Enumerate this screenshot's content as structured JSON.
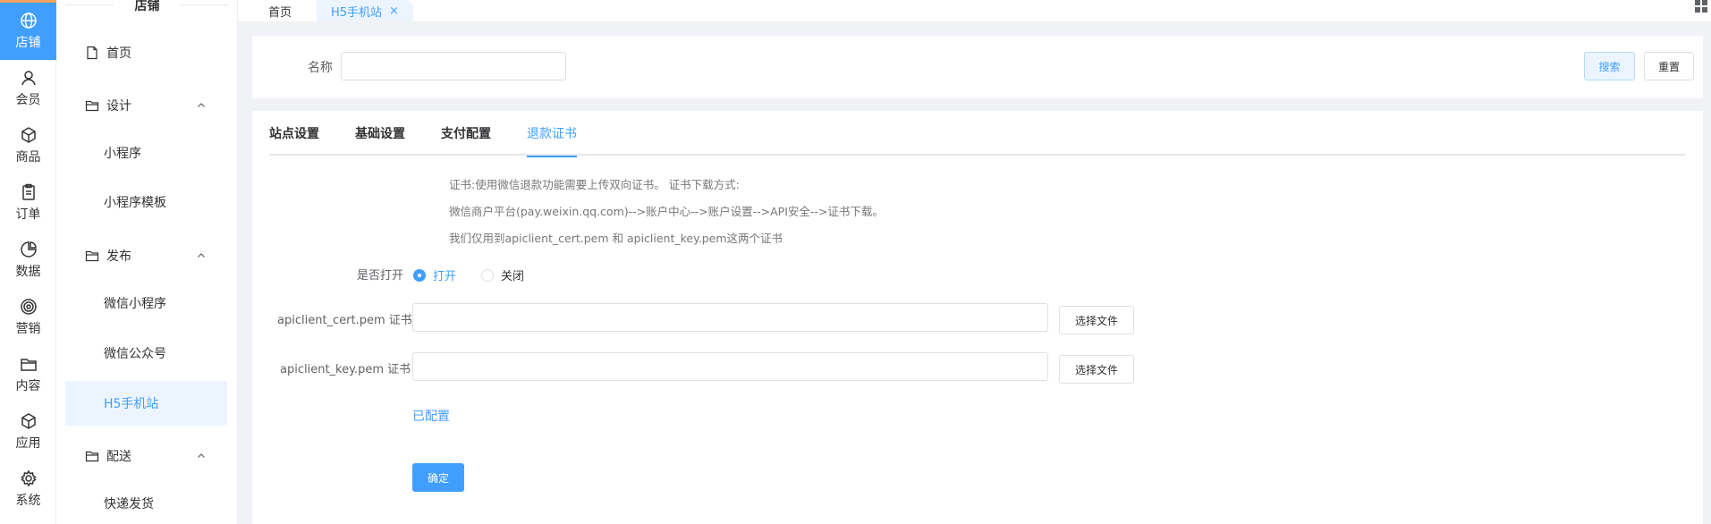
{
  "rail": {
    "items": [
      {
        "label": "店铺",
        "icon": "globe-icon"
      },
      {
        "label": "会员",
        "icon": "user-icon"
      },
      {
        "label": "商品",
        "icon": "box-icon"
      },
      {
        "label": "订单",
        "icon": "clipboard-icon"
      },
      {
        "label": "数据",
        "icon": "pie-chart-icon"
      },
      {
        "label": "营销",
        "icon": "target-icon"
      },
      {
        "label": "内容",
        "icon": "folder-icon"
      },
      {
        "label": "应用",
        "icon": "cube-icon"
      },
      {
        "label": "系统",
        "icon": "gear-icon"
      }
    ]
  },
  "menu": {
    "title": "店铺",
    "items": [
      {
        "label": "首页"
      },
      {
        "label": "设计"
      },
      {
        "label": "小程序"
      },
      {
        "label": "小程序模板"
      },
      {
        "label": "发布"
      },
      {
        "label": "微信小程序"
      },
      {
        "label": "微信公众号"
      },
      {
        "label": "H5手机站"
      },
      {
        "label": "配送"
      },
      {
        "label": "快递发货"
      }
    ]
  },
  "tabs": {
    "home": "首页",
    "current": "H5手机站",
    "close": "×"
  },
  "search": {
    "name_label": "名称",
    "name_value": "",
    "search_label": "搜索",
    "reset_label": "重置"
  },
  "content_tabs": [
    "站点设置",
    "基础设置",
    "支付配置",
    "退款证书"
  ],
  "form": {
    "notes": [
      "证书:使用微信退款功能需要上传双向证书。 证书下载方式:",
      "微信商户平台(pay.weixin.qq.com)-->账户中心-->账户设置-->API安全-->证书下载。",
      "我们仅用到apiclient_cert.pem 和 apiclient_key.pem这两个证书"
    ],
    "open_label": "是否打开",
    "open_on": "打开",
    "open_off": "关闭",
    "cert_label": "apiclient_cert.pem 证书",
    "cert_value": "",
    "key_label": "apiclient_key.pem 证书",
    "key_value": "",
    "choose_file": "选择文件",
    "configured": "已配置",
    "confirm": "确定"
  },
  "colors": {
    "accent": "#409eff",
    "accent_light": "#ecf5ff"
  }
}
